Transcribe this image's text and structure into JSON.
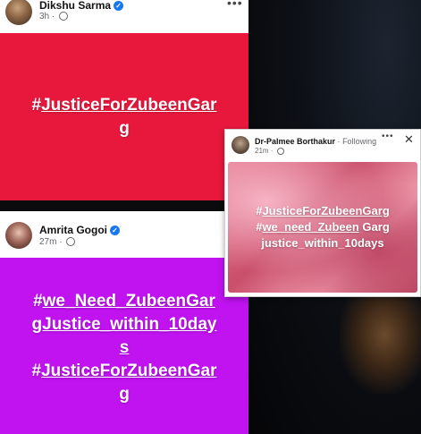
{
  "post1": {
    "author": "Dikshu Sarma",
    "time": "3h",
    "text_hash": "#",
    "text_tag_a": "JusticeForZubeenGar",
    "text_tag_b": "g",
    "bg_color": "#e8183d"
  },
  "post2": {
    "author": "Amrita Gogoi",
    "time": "27m",
    "line1_hash": "#",
    "line1_tag": "we_Need_ZubeenGar",
    "line2": "gJustice_within_10day",
    "line3": "s",
    "line4_hash": "#",
    "line4_tag": "JusticeForZubeenGar",
    "line5": "g",
    "bg_color": "#c013f0"
  },
  "post3": {
    "author": "Dr-Palmee Borthakur",
    "separator": "·",
    "follow_label": "Following",
    "time": "21m",
    "line1_hash": "#",
    "line1_tag": "JusticeForZubeenGarg",
    "line2_hash": "#",
    "line2_tag": "we_need_Zubeen",
    "line2_rest": " Garg",
    "line3": "justice_within_10days",
    "close_label": "✕"
  },
  "icons": {
    "verified": "verified-badge-icon",
    "more": "more-options-icon",
    "audience": "public-globe-icon",
    "close": "close-icon"
  }
}
